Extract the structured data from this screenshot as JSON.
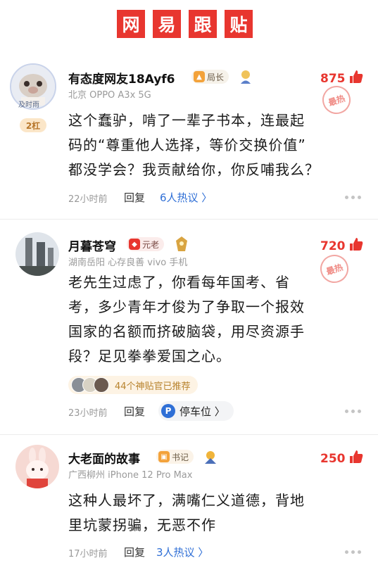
{
  "header": {
    "chars": [
      "网",
      "易",
      "跟",
      "贴"
    ]
  },
  "comments": [
    {
      "username": "有态度网友18Ayf6",
      "badge": "局长",
      "meta": "北京  OPPO A3x 5G",
      "likes": "875",
      "stamp": "最热",
      "rank": "2杠",
      "avatar_caption": "及时雨",
      "text_lines": [
        "这个蠢驴，啃了一辈子书本，连最起",
        "码的“尊重他人选择，等价交换价值”",
        "都没学会？我贡献给你，你反哺我么？"
      ],
      "time": "22小时前",
      "reply": "回复",
      "hot": "6人热议 〉"
    },
    {
      "username": "月暮苍穹",
      "badge": "元老",
      "meta": "湖南岳阳  心存良善  vivo 手机",
      "likes": "720",
      "stamp": "最热",
      "text_lines": [
        "老先生过虑了，你看每年国考、省",
        "考，多少青年才俊为了争取一个报效",
        "国家的名额而挤破脑袋，用尽资源手",
        "段？足见拳拳爱国之心。"
      ],
      "recommend": "44个神贴官已推荐",
      "time": "23小时前",
      "reply": "回复",
      "park": "停车位 〉",
      "park_icon": "P"
    },
    {
      "username": "大老面的故事",
      "badge": "书记",
      "meta": "广西柳州  iPhone 12 Pro Max",
      "likes": "250",
      "text_lines": [
        "这种人最坏了，满嘴仁义道德，背地",
        "里坑蒙拐骗，无恶不作"
      ],
      "time": "17小时前",
      "reply": "回复",
      "hot": "3人热议 〉"
    }
  ],
  "colors": {
    "accent_red": "#e8362f",
    "link_blue": "#2f6fd6",
    "meta_gray": "#9a9a9a"
  },
  "icons": [
    "thumbs-up-icon",
    "avatar-frame-icon",
    "medal-icon",
    "rank-badge-icon",
    "more-dots-icon"
  ]
}
